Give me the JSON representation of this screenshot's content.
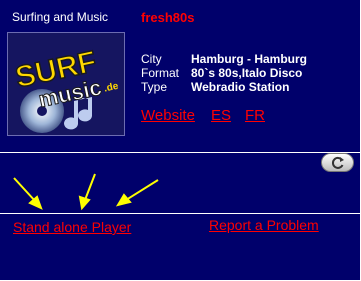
{
  "header": {
    "title": "Surfing and Music",
    "station_name": "fresh80s"
  },
  "logo": {
    "text_main": "SURF",
    "text_sub": "music",
    "text_domain": ".de"
  },
  "info": {
    "city_label": "City",
    "city_value": "Hamburg - Hamburg",
    "format_label": "Format",
    "format_value": "80`s 80s,Italo Disco",
    "type_label": "Type",
    "type_value": "Webradio Station"
  },
  "links": {
    "website": "Website",
    "es": "ES",
    "fr": "FR",
    "standalone_player": "Stand alone Player",
    "report_problem": "Report a Problem"
  },
  "colors": {
    "background": "#00006b",
    "link": "#ff0000",
    "arrow": "#ffff00"
  },
  "icons": {
    "refresh": "refresh-icon",
    "arrows": "yellow-pointer-arrows"
  }
}
